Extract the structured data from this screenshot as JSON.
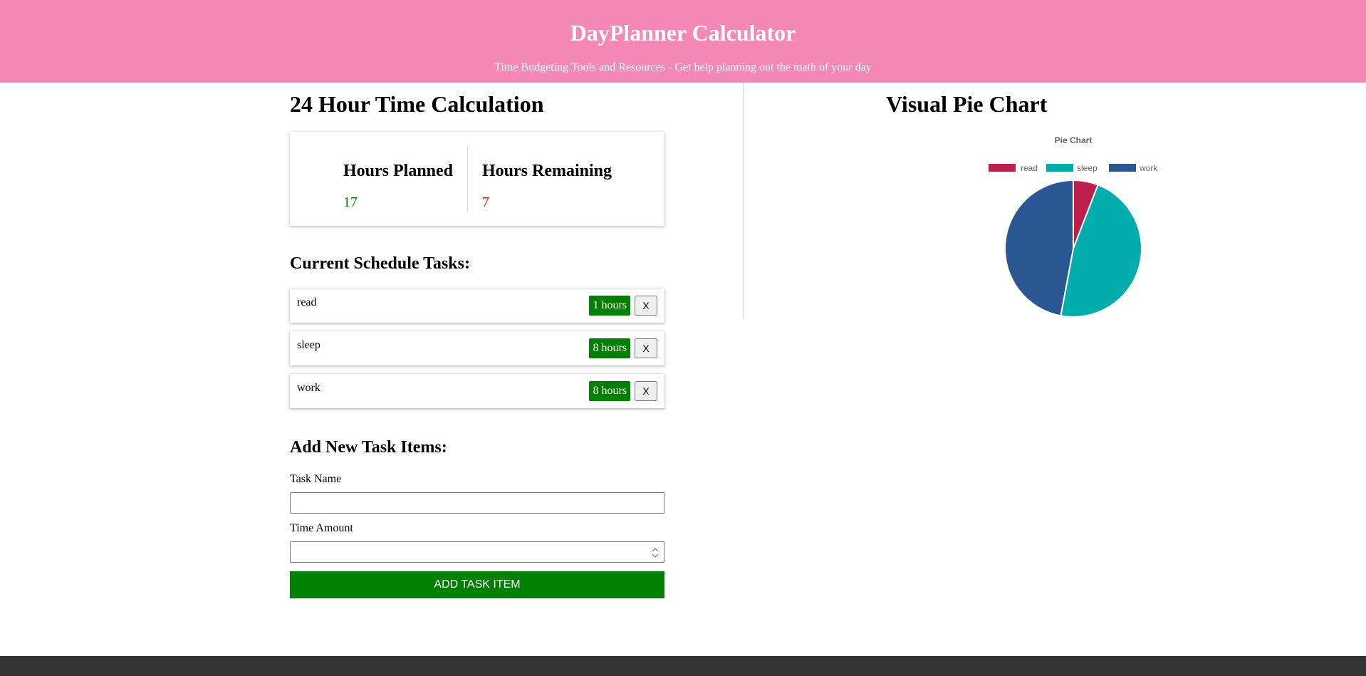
{
  "header": {
    "title": "DayPlanner Calculator",
    "subtitle": "Time Budgeting Tools and Resources - Get help planning out the math of your day"
  },
  "calculation": {
    "title": "24 Hour Time Calculation",
    "planned_label": "Hours Planned",
    "planned_value": "17",
    "remaining_label": "Hours Remaining",
    "remaining_value": "7",
    "colors": {
      "planned": "#008000",
      "remaining": "#ff0000"
    }
  },
  "schedule": {
    "title": "Current Schedule Tasks:",
    "tasks": [
      {
        "name": "read",
        "hours_label": "1 hours",
        "delete_label": "X"
      },
      {
        "name": "sleep",
        "hours_label": "8 hours",
        "delete_label": "X"
      },
      {
        "name": "work",
        "hours_label": "8 hours",
        "delete_label": "X"
      }
    ]
  },
  "add_form": {
    "title": "Add New Task Items:",
    "task_name_label": "Task Name",
    "task_name_value": "",
    "time_amount_label": "Time Amount",
    "time_amount_value": "",
    "submit_label": "ADD TASK ITEM"
  },
  "chart_panel": {
    "title": "Visual Pie Chart"
  },
  "chart_data": {
    "type": "pie",
    "title": "Pie Chart",
    "legend": "top",
    "labels": [
      "read",
      "sleep",
      "work"
    ],
    "values": [
      1,
      8,
      8
    ],
    "colors": [
      "#bc1f4b",
      "#00adad",
      "#2a5793"
    ]
  },
  "theme": {
    "header_bg": "#f688b8",
    "accent_green": "#008000",
    "footer_bg": "#333333"
  }
}
